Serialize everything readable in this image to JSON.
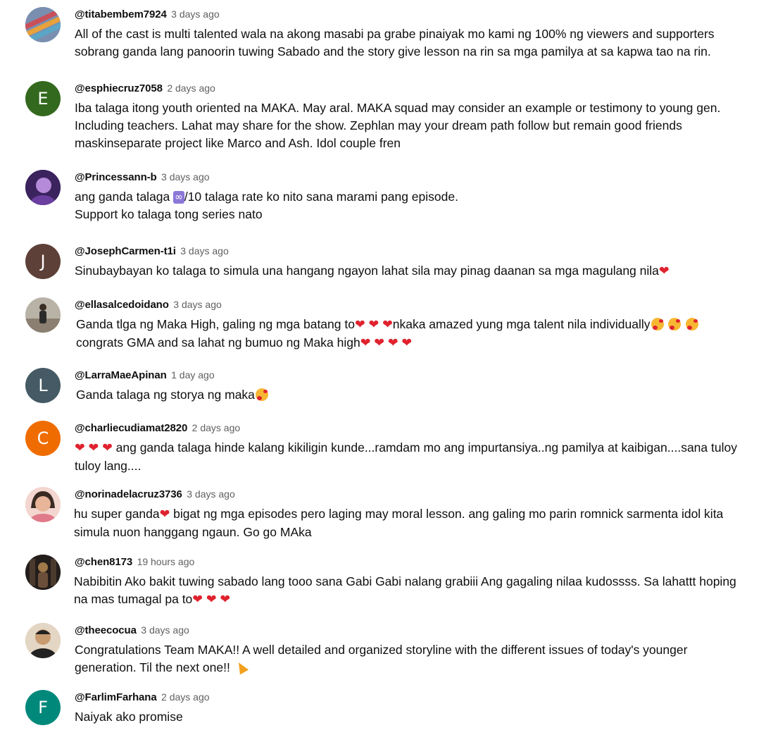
{
  "comments": [
    {
      "author": "@titabembem7924",
      "time": "3 days ago",
      "avatar": {
        "kind": "photo",
        "colors": [
          "#3b6ea8",
          "#c94f5a",
          "#e8a23b",
          "#5aa6c7"
        ]
      },
      "lines": [
        "All of the cast is multi talented wala na akong masabi pa grabe pinaiyak mo kami ng 100% ng viewers and supporters",
        "sobrang ganda lang panoorin tuwing Sabado and the story give lesson na rin sa mga pamilya at sa kapwa tao na rin."
      ]
    },
    {
      "author": "@esphiecruz7058",
      "time": "2 days ago",
      "avatar": {
        "kind": "letter",
        "letter": "E",
        "color": "#33691e"
      },
      "lines": [
        "Iba talaga itong youth oriented na MAKA. May aral. MAKA squad may consider an example or testimony to young gen.",
        "Including teachers. Lahat may share for the show. Zephlan may your dream path follow but remain good friends",
        "maskinseparate project like Marco and Ash. Idol couple fren"
      ]
    },
    {
      "author": "@Princessann-b",
      "time": "3 days ago",
      "avatar": {
        "kind": "photo",
        "colors": [
          "#2a1a4a",
          "#6a3fa0",
          "#b58ad8"
        ]
      },
      "segments_line1": [
        "ang ganda talaga ",
        "♾️",
        "/10 talaga rate ko nito sana marami pang episode."
      ],
      "lines": [
        "Support ko talaga tong series nato"
      ]
    },
    {
      "author": "@JosephCarmen-t1i",
      "time": "3 days ago",
      "avatar": {
        "kind": "letter",
        "letter": "J",
        "color": "#5d4037"
      },
      "lines": [
        "Sinubaybayan ko talaga to simula una hangang ngayon lahat sila may pinag daanan sa mga magulang nila"
      ],
      "emoji_after": "❤"
    },
    {
      "author": "@ellasalcedoidano",
      "time": "3 days ago",
      "avatar": {
        "kind": "photo",
        "colors": [
          "#c9c3b8",
          "#2b2b2b",
          "#8a7f70"
        ]
      },
      "line1_parts": [
        "Ganda tlga ng Maka High, galing ng mga batang to",
        "nkaka amazed yung mga talent nila individually"
      ],
      "line2_parts": [
        "congrats GMA and sa lahat ng bumuo ng Maka high"
      ]
    },
    {
      "author": "@LarraMaeApinan",
      "time": "1 day ago",
      "avatar": {
        "kind": "letter",
        "letter": "L",
        "color": "#455a64"
      },
      "lines": [
        "Ganda talaga ng storya ng maka"
      ]
    },
    {
      "author": "@charliecudiamat2820",
      "time": "2 days ago",
      "avatar": {
        "kind": "letter",
        "letter": "C",
        "color": "#ef6c00"
      },
      "line1_text": " ang ganda talaga hinde kalang kikiligin kunde...ramdam mo ang impurtansiya..ng pamilya at kaibigan....sana tuloy",
      "lines": [
        "tuloy lang...."
      ]
    },
    {
      "author": "@norinadelacruz3736",
      "time": "3 days ago",
      "avatar": {
        "kind": "photo",
        "colors": [
          "#f1c9c4",
          "#3a2a22",
          "#e07a8a"
        ]
      },
      "line1_parts": [
        "hu super ganda",
        "  bigat ng mga episodes pero laging may moral lesson. ang galing mo parin romnick sarmenta idol kita"
      ],
      "lines": [
        "simula nuon hanggang ngaun. Go go MAka"
      ]
    },
    {
      "author": "@chen8173",
      "time": "19 hours ago",
      "avatar": {
        "kind": "photo",
        "colors": [
          "#1e1a1a",
          "#6b4f3a",
          "#a07a4a"
        ]
      },
      "lines": [
        "Nabibitin Ako bakit tuwing sabado lang tooo sana Gabi Gabi nalang grabiii Ang gagaling nilaa kudossss. Sa lahattt hoping"
      ],
      "line2_text": "na mas tumagal pa to"
    },
    {
      "author": "@theecocua",
      "time": "3 days ago",
      "avatar": {
        "kind": "photo",
        "colors": [
          "#d9b48a",
          "#222222",
          "#7a5a3a"
        ]
      },
      "lines": [
        "Congratulations Team MAKA!! A well detailed and organized storyline with the different issues of today's younger"
      ],
      "line2_text": "generation. Til the next one!! "
    },
    {
      "author": "@FarlimFarhana",
      "time": "2 days ago",
      "avatar": {
        "kind": "letter",
        "letter": "F",
        "color": "#00897b"
      },
      "lines": [
        "Naiyak ako promise"
      ]
    }
  ],
  "emoji": {
    "heart": "❤",
    "infinity": "♾️"
  },
  "colors": {
    "text": "#0f0f0f",
    "meta": "#606060",
    "heart": "#e0222e"
  }
}
